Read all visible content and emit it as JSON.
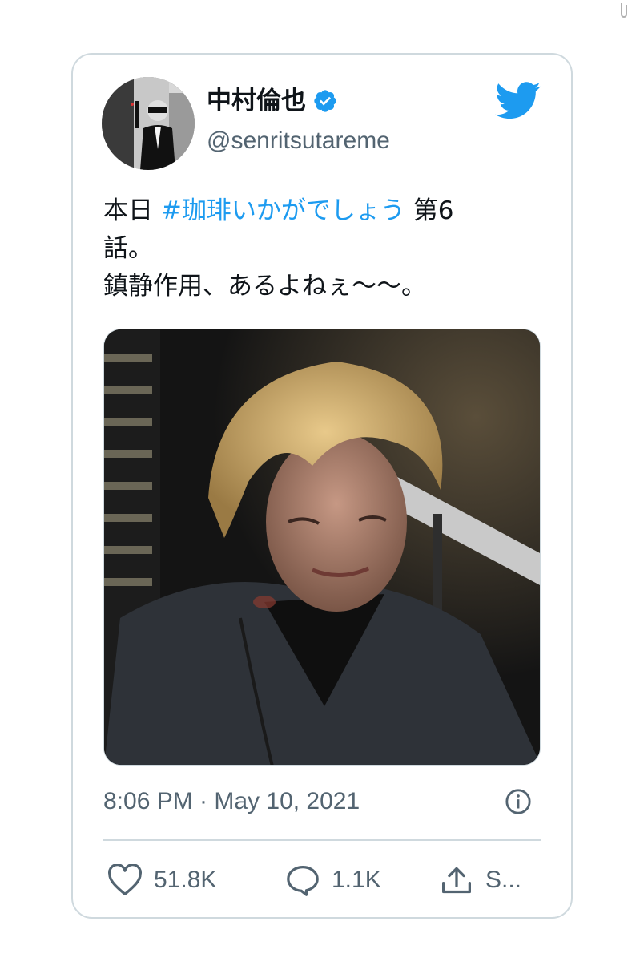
{
  "tweet": {
    "display_name": "中村倫也",
    "handle": "@senritsutareme",
    "text_lines": {
      "l1_prefix": "本日 ",
      "hashtag": "#珈琲いかがでしょう",
      "l1_suffix": " 第6",
      "l2": "話。",
      "l3": "鎮静作用、あるよねぇ〜〜。"
    },
    "timestamp": "8:06 PM · May 10, 2021",
    "actions": {
      "likes": "51.8K",
      "replies": "1.1K",
      "share": "S..."
    }
  },
  "icons": {
    "verified": "verified-badge-icon",
    "brand": "twitter-bird-icon",
    "info": "info-icon",
    "like": "heart-icon",
    "reply": "speech-bubble-icon",
    "share": "upload-share-icon"
  },
  "colors": {
    "accent": "#1d9bf0",
    "text": "#0f1419",
    "secondary": "#536471",
    "border": "#cfd9de"
  }
}
